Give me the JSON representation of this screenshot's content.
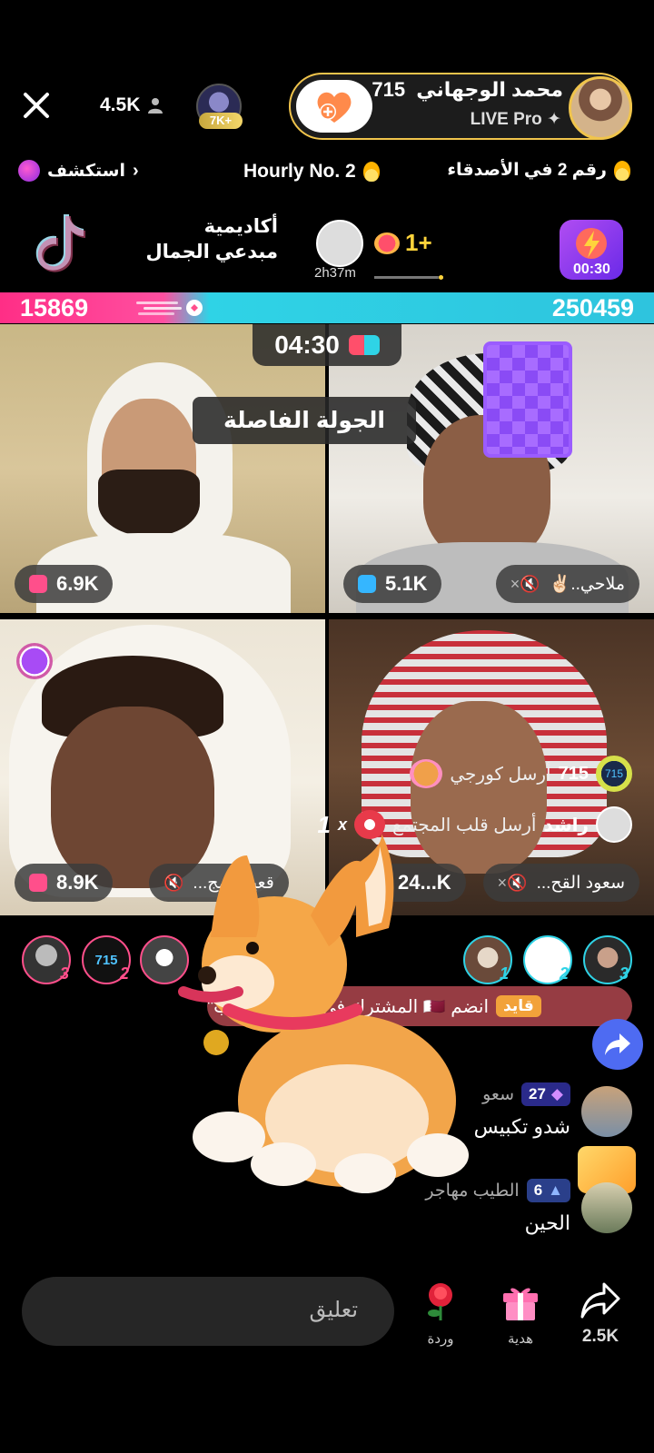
{
  "header": {
    "viewer_count": "4.5K",
    "top_viewer_badge": "7K+",
    "host_name": "محمد الوجهاني",
    "host_level": "715",
    "host_sub": "LIVE Pro ✦",
    "icons": [
      "close-icon",
      "person-icon",
      "heart-plus-icon"
    ]
  },
  "ranking": {
    "explore": "استكشف",
    "hourly": "Hourly No. 2",
    "friends_rank": "رقم 2 في الأصدقاء"
  },
  "session": {
    "academy": "أكاديمية مبدعي الجمال",
    "duration": "2h37m",
    "plus": "1+",
    "boost_timer": "00:30"
  },
  "battle": {
    "score_left": "15869",
    "score_right": "250459",
    "timer": "04:30",
    "round_title": "الجولة الفاصلة"
  },
  "tiles": [
    {
      "score": "6.9K"
    },
    {
      "score": "5.1K",
      "name": "ملاحي..✌🏻"
    },
    {
      "score": "8.9K",
      "name": "قعيد المج..."
    },
    {
      "score": "24...K",
      "name": "سعود القح..."
    }
  ],
  "gifts": [
    {
      "user": "715",
      "text": "أرسل كورجي",
      "level": "715"
    },
    {
      "user": "راشد",
      "text": "أرسل قلب المجتمع",
      "count": "1",
      "mult": "x"
    }
  ],
  "top_gifters_left": [
    {
      "rank": "3"
    },
    {
      "rank": "2",
      "label": "715"
    },
    {
      "rank": ""
    }
  ],
  "top_gifters_right": [
    {
      "rank": "1"
    },
    {
      "rank": "2"
    },
    {
      "rank": "3"
    }
  ],
  "join_banner": {
    "tag": "قايد",
    "text": "انضم 🇶🇦 المشترك في \"أفضل معجب\""
  },
  "chat": [
    {
      "user": "سعو",
      "badge": "27",
      "message": "شدو تكبيس"
    },
    {
      "user": "الطيب مهاجر",
      "badge": "6",
      "message": "الحين"
    }
  ],
  "bottom": {
    "comment_placeholder": "تعليق",
    "rose_label": "وردة",
    "gift_label": "هدية",
    "share_count": "2.5K"
  },
  "colors": {
    "score_pink": "#ff2e86",
    "score_cyan": "#2fd3e6",
    "accent_gold": "#f0c44c",
    "share_blue": "#4e6bf2"
  }
}
